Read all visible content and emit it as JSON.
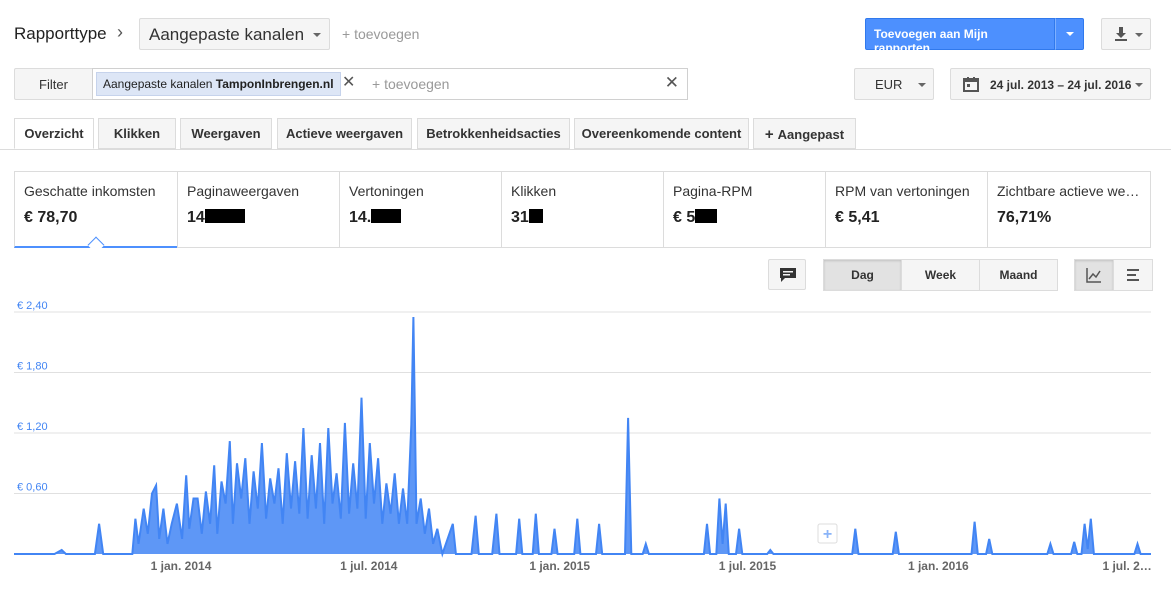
{
  "header": {
    "breadcrumb_label": "Rapporttype",
    "breadcrumb_separator": "›",
    "report_type": "Aangepaste kanalen",
    "add_link": "+ toevoegen",
    "add_to_reports_label": "Toevoegen aan Mijn rapporten"
  },
  "filter": {
    "button_label": "Filter",
    "chip_prefix": "Aangepaste kanalen",
    "chip_value": "TamponInbrengen.nl",
    "add_placeholder": "+ toevoegen",
    "currency": "EUR",
    "date_range": "24 jul. 2013 – 24 jul. 2016"
  },
  "tabs": [
    {
      "label": "Overzicht"
    },
    {
      "label": "Klikken"
    },
    {
      "label": "Weergaven"
    },
    {
      "label": "Actieve weergaven"
    },
    {
      "label": "Betrokkenheidsacties"
    },
    {
      "label": "Overeenkomende content"
    },
    {
      "label": "Aangepast"
    }
  ],
  "metrics": [
    {
      "label": "Geschatte inkomsten",
      "value": "€ 78,70"
    },
    {
      "label": "Paginaweergaven",
      "value": "14"
    },
    {
      "label": "Vertoningen",
      "value": "14."
    },
    {
      "label": "Klikken",
      "value": "31"
    },
    {
      "label": "Pagina-RPM",
      "value": "€ 5"
    },
    {
      "label": "RPM van vertoningen",
      "value": "€ 5,41"
    },
    {
      "label": "Zichtbare actieve we…",
      "value": "76,71%"
    }
  ],
  "controls": {
    "granularity": [
      "Dag",
      "Week",
      "Maand"
    ],
    "selected_granularity": "Dag"
  },
  "colors": {
    "accent": "#4d90fe",
    "line": "#4285f4",
    "axis_label": "#4285f4"
  },
  "chart_data": {
    "type": "area",
    "title": "",
    "xlabel": "",
    "ylabel": "",
    "ylim": [
      0,
      2.4
    ],
    "yticks": [
      "€ 0,60",
      "€ 1,20",
      "€ 1,80",
      "€ 2,40"
    ],
    "ytick_values": [
      0.6,
      1.2,
      1.8,
      2.4
    ],
    "xticks": [
      "1 jan. 2014",
      "1 jul. 2014",
      "1 jan. 2015",
      "1 jul. 2015",
      "1 jan. 2016",
      "1 jul. 2…"
    ],
    "xtick_dates": [
      "2014-01-01",
      "2014-07-01",
      "2015-01-01",
      "2015-07-01",
      "2016-01-01",
      "2016-07-01"
    ],
    "x_range": [
      "2013-07-24",
      "2016-07-24"
    ],
    "grid": true,
    "series": [
      {
        "points": [
          [
            "2013-07-24",
            0
          ],
          [
            "2013-09-01",
            0
          ],
          [
            "2013-09-08",
            0.04
          ],
          [
            "2013-09-12",
            0
          ],
          [
            "2013-10-10",
            0
          ],
          [
            "2013-10-14",
            0.3
          ],
          [
            "2013-10-18",
            0
          ],
          [
            "2013-11-15",
            0
          ],
          [
            "2013-11-18",
            0.35
          ],
          [
            "2013-11-21",
            0.1
          ],
          [
            "2013-11-26",
            0.45
          ],
          [
            "2013-11-30",
            0.2
          ],
          [
            "2013-12-04",
            0.6
          ],
          [
            "2013-12-08",
            0.68
          ],
          [
            "2013-12-11",
            0.15
          ],
          [
            "2013-12-15",
            0.45
          ],
          [
            "2013-12-19",
            0.1
          ],
          [
            "2013-12-23",
            0.3
          ],
          [
            "2013-12-28",
            0.5
          ],
          [
            "2014-01-02",
            0.15
          ],
          [
            "2014-01-06",
            0.78
          ],
          [
            "2014-01-09",
            0.25
          ],
          [
            "2014-01-13",
            0.55
          ],
          [
            "2014-01-17",
            0.55
          ],
          [
            "2014-01-21",
            0.2
          ],
          [
            "2014-01-25",
            0.62
          ],
          [
            "2014-01-29",
            0.3
          ],
          [
            "2014-02-02",
            0.88
          ],
          [
            "2014-02-05",
            0.2
          ],
          [
            "2014-02-09",
            0.72
          ],
          [
            "2014-02-13",
            0.5
          ],
          [
            "2014-02-17",
            1.12
          ],
          [
            "2014-02-20",
            0.3
          ],
          [
            "2014-02-24",
            0.9
          ],
          [
            "2014-02-28",
            0.55
          ],
          [
            "2014-03-04",
            0.95
          ],
          [
            "2014-03-08",
            0.3
          ],
          [
            "2014-03-12",
            0.82
          ],
          [
            "2014-03-16",
            0.45
          ],
          [
            "2014-03-20",
            1.1
          ],
          [
            "2014-03-24",
            0.35
          ],
          [
            "2014-03-28",
            0.75
          ],
          [
            "2014-04-01",
            0.5
          ],
          [
            "2014-04-05",
            0.85
          ],
          [
            "2014-04-09",
            0.3
          ],
          [
            "2014-04-13",
            1.0
          ],
          [
            "2014-04-17",
            0.45
          ],
          [
            "2014-04-21",
            0.92
          ],
          [
            "2014-04-25",
            0.4
          ],
          [
            "2014-04-29",
            1.25
          ],
          [
            "2014-05-03",
            0.35
          ],
          [
            "2014-05-07",
            0.98
          ],
          [
            "2014-05-11",
            0.45
          ],
          [
            "2014-05-15",
            1.1
          ],
          [
            "2014-05-19",
            0.3
          ],
          [
            "2014-05-23",
            1.25
          ],
          [
            "2014-05-27",
            0.5
          ],
          [
            "2014-05-31",
            0.8
          ],
          [
            "2014-06-04",
            0.35
          ],
          [
            "2014-06-08",
            1.3
          ],
          [
            "2014-06-12",
            0.4
          ],
          [
            "2014-06-16",
            0.9
          ],
          [
            "2014-06-20",
            0.45
          ],
          [
            "2014-06-24",
            1.55
          ],
          [
            "2014-06-28",
            0.35
          ],
          [
            "2014-07-02",
            1.1
          ],
          [
            "2014-07-06",
            0.5
          ],
          [
            "2014-07-10",
            0.95
          ],
          [
            "2014-07-14",
            0.3
          ],
          [
            "2014-07-18",
            0.7
          ],
          [
            "2014-07-22",
            0.4
          ],
          [
            "2014-07-26",
            0.8
          ],
          [
            "2014-07-30",
            0.3
          ],
          [
            "2014-08-03",
            0.65
          ],
          [
            "2014-08-07",
            0.3
          ],
          [
            "2014-08-11",
            1.28
          ],
          [
            "2014-08-13",
            2.35
          ],
          [
            "2014-08-16",
            0.3
          ],
          [
            "2014-08-20",
            0.55
          ],
          [
            "2014-08-24",
            0.2
          ],
          [
            "2014-08-28",
            0.45
          ],
          [
            "2014-09-01",
            0.1
          ],
          [
            "2014-09-05",
            0.25
          ],
          [
            "2014-09-10",
            0
          ],
          [
            "2014-09-20",
            0.3
          ],
          [
            "2014-09-23",
            0
          ],
          [
            "2014-10-08",
            0
          ],
          [
            "2014-10-12",
            0.38
          ],
          [
            "2014-10-15",
            0
          ],
          [
            "2014-10-28",
            0
          ],
          [
            "2014-11-01",
            0.4
          ],
          [
            "2014-11-04",
            0
          ],
          [
            "2014-11-20",
            0
          ],
          [
            "2014-11-23",
            0.35
          ],
          [
            "2014-11-26",
            0
          ],
          [
            "2014-12-06",
            0
          ],
          [
            "2014-12-09",
            0.4
          ],
          [
            "2014-12-12",
            0
          ],
          [
            "2014-12-24",
            0
          ],
          [
            "2014-12-27",
            0.25
          ],
          [
            "2014-12-30",
            0
          ],
          [
            "2015-01-15",
            0
          ],
          [
            "2015-01-18",
            0.35
          ],
          [
            "2015-01-21",
            0
          ],
          [
            "2015-02-05",
            0
          ],
          [
            "2015-02-08",
            0.3
          ],
          [
            "2015-02-11",
            0
          ],
          [
            "2015-03-05",
            0
          ],
          [
            "2015-03-08",
            1.35
          ],
          [
            "2015-03-11",
            0
          ],
          [
            "2015-03-22",
            0
          ],
          [
            "2015-03-25",
            0.1
          ],
          [
            "2015-03-28",
            0
          ],
          [
            "2015-05-20",
            0
          ],
          [
            "2015-05-23",
            0.3
          ],
          [
            "2015-05-26",
            0
          ],
          [
            "2015-06-01",
            0
          ],
          [
            "2015-06-04",
            0.55
          ],
          [
            "2015-06-07",
            0.1
          ],
          [
            "2015-06-10",
            0.5
          ],
          [
            "2015-06-13",
            0
          ],
          [
            "2015-06-20",
            0
          ],
          [
            "2015-06-23",
            0.25
          ],
          [
            "2015-06-26",
            0
          ],
          [
            "2015-07-20",
            0
          ],
          [
            "2015-07-23",
            0.04
          ],
          [
            "2015-07-26",
            0
          ],
          [
            "2015-10-10",
            0
          ],
          [
            "2015-10-13",
            0.25
          ],
          [
            "2015-10-16",
            0
          ],
          [
            "2015-11-18",
            0
          ],
          [
            "2015-11-21",
            0.22
          ],
          [
            "2015-11-24",
            0
          ],
          [
            "2016-02-02",
            0
          ],
          [
            "2016-02-05",
            0.32
          ],
          [
            "2016-02-08",
            0
          ],
          [
            "2016-02-16",
            0
          ],
          [
            "2016-02-19",
            0.15
          ],
          [
            "2016-02-22",
            0
          ],
          [
            "2016-04-15",
            0
          ],
          [
            "2016-04-18",
            0.1
          ],
          [
            "2016-04-21",
            0
          ],
          [
            "2016-05-08",
            0
          ],
          [
            "2016-05-11",
            0.12
          ],
          [
            "2016-05-14",
            0
          ],
          [
            "2016-05-18",
            0
          ],
          [
            "2016-05-21",
            0.3
          ],
          [
            "2016-05-24",
            0.05
          ],
          [
            "2016-05-27",
            0.35
          ],
          [
            "2016-05-30",
            0
          ],
          [
            "2016-07-08",
            0
          ],
          [
            "2016-07-11",
            0.1
          ],
          [
            "2016-07-14",
            0
          ],
          [
            "2016-07-24",
            0
          ]
        ]
      }
    ]
  }
}
